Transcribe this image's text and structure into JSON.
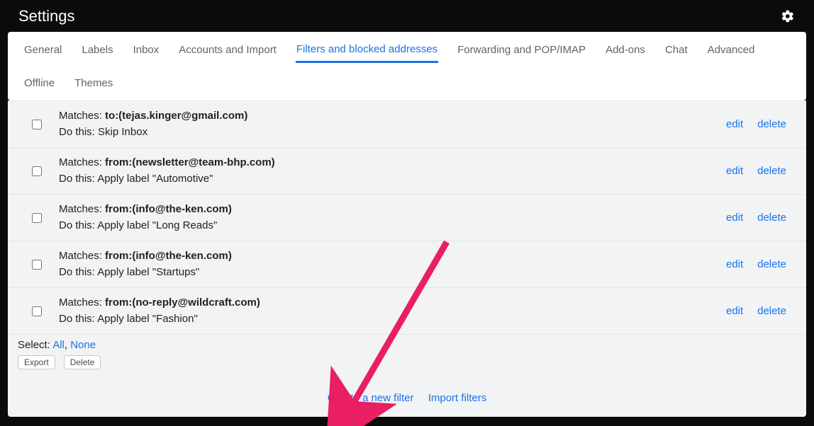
{
  "header": {
    "title": "Settings"
  },
  "tabs": [
    {
      "label": "General",
      "active": false
    },
    {
      "label": "Labels",
      "active": false
    },
    {
      "label": "Inbox",
      "active": false
    },
    {
      "label": "Accounts and Import",
      "active": false
    },
    {
      "label": "Filters and blocked addresses",
      "active": true
    },
    {
      "label": "Forwarding and POP/IMAP",
      "active": false
    },
    {
      "label": "Add-ons",
      "active": false
    },
    {
      "label": "Chat",
      "active": false
    },
    {
      "label": "Advanced",
      "active": false
    },
    {
      "label": "Offline",
      "active": false
    },
    {
      "label": "Themes",
      "active": false
    }
  ],
  "ui": {
    "matches_label": "Matches: ",
    "dothis_label": "Do this: ",
    "edit_label": "edit",
    "delete_label": "delete",
    "select_label": "Select: ",
    "all_label": "All",
    "none_label": "None",
    "export_label": "Export",
    "delete_btn_label": "Delete",
    "create_label": "Create a new filter",
    "import_label": "Import filters"
  },
  "filters": [
    {
      "criteria": "to:(tejas.kinger@gmail.com)",
      "action": "Skip Inbox"
    },
    {
      "criteria": "from:(newsletter@team-bhp.com)",
      "action": "Apply label \"Automotive\""
    },
    {
      "criteria": "from:(info@the-ken.com)",
      "action": "Apply label \"Long Reads\""
    },
    {
      "criteria": "from:(info@the-ken.com)",
      "action": "Apply label \"Startups\""
    },
    {
      "criteria": "from:(no-reply@wildcraft.com)",
      "action": "Apply label \"Fashion\""
    }
  ]
}
